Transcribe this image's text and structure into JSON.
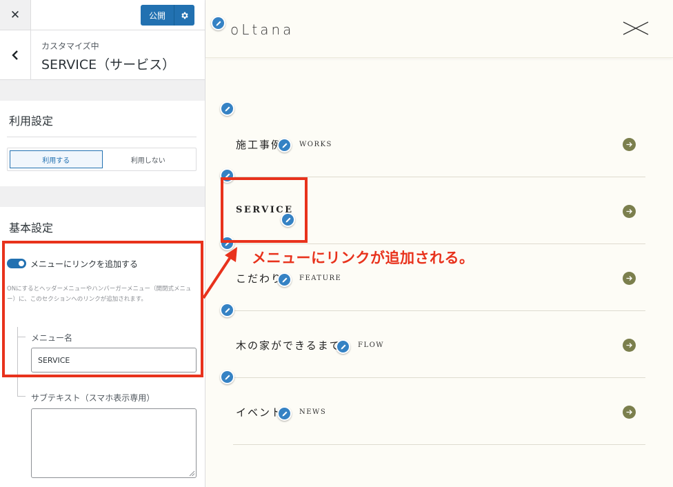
{
  "customizer": {
    "close_glyph": "✕",
    "publish_label": "公開",
    "breadcrumb": "カスタマイズ中",
    "section_title": "SERVICE（サービス）",
    "usage": {
      "title": "利用設定",
      "options": [
        "利用する",
        "利用しない"
      ],
      "selected": "利用する"
    },
    "basic": {
      "title": "基本設定",
      "toggle_label": "メニューにリンクを追加する",
      "toggle_on": true,
      "help_text": "ONにするとヘッダーメニューやハンバーガーメニュー（開閉式メニュー）に、このセクションへのリンクが追加されます。",
      "menu_name_label": "メニュー名",
      "menu_name_value": "SERVICE",
      "subtext_label": "サブテキスト（スマホ表示専用）",
      "subtext_value": ""
    },
    "accent_color": "#2271b1"
  },
  "preview": {
    "logo": "oLtana",
    "menu": [
      {
        "ja": "施工事例",
        "en": "WORKS"
      },
      {
        "ja": "SERVICE",
        "en": ""
      },
      {
        "ja": "こだわり",
        "en": "FEATURE"
      },
      {
        "ja": "木の家ができるまで",
        "en": "FLOW"
      },
      {
        "ja": "イベント",
        "en": "NEWS"
      }
    ],
    "arrow_color": "#7b7f4d",
    "edit_icon_color": "#3582c4"
  },
  "annotation": {
    "text": "メニューにリンクが追加される。",
    "color": "#e8321c"
  }
}
